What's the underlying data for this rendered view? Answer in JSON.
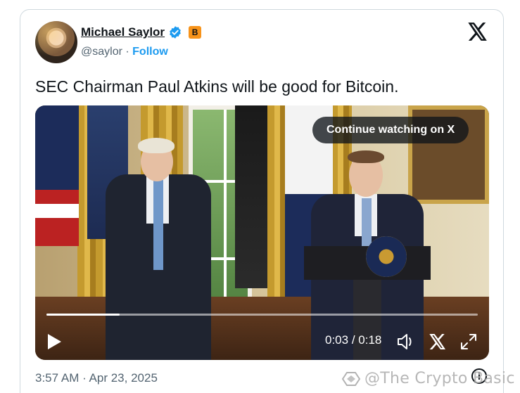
{
  "author": {
    "name": "Michael Saylor",
    "handle": "@saylor",
    "separator": "·",
    "follow_label": "Follow",
    "badge_letter": "B",
    "verified_color": "#1d9bf0",
    "badge_color": "#f7931a"
  },
  "platform_icon": "x-logo-icon",
  "tweet": {
    "text": "SEC Chairman Paul Atkins will be good for Bitcoin."
  },
  "video": {
    "continue_label": "Continue watching on X",
    "current_time": "0:03",
    "time_separator": " / ",
    "duration": "0:18",
    "progress_fraction": 0.17,
    "icons": [
      "play-icon",
      "volume-icon",
      "x-logo-icon",
      "fullscreen-icon"
    ]
  },
  "footer": {
    "timestamp": "3:57 AM · Apr 23, 2025",
    "info_glyph": "i"
  },
  "watermark": {
    "text": "@The Crypto Basic"
  }
}
